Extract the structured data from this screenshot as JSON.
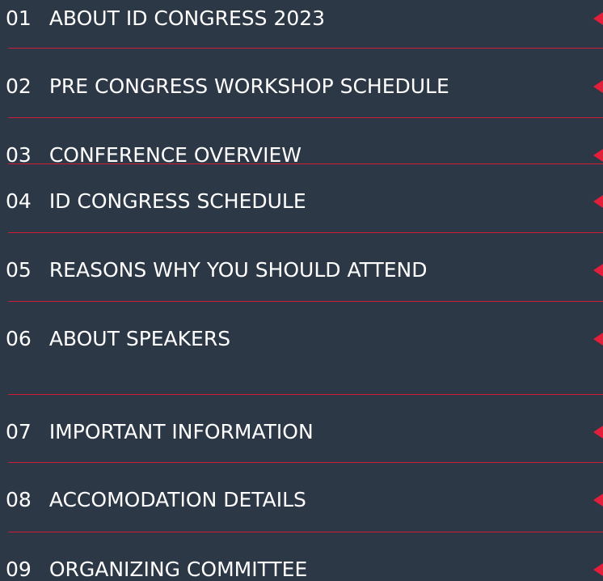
{
  "menu": {
    "accent_color": "#e31e3a",
    "background_color": "#2d3847",
    "items": [
      {
        "number": "01",
        "title": "ABOUT ID CONGRESS 2023",
        "icon": "caret-left-icon"
      },
      {
        "number": "02",
        "title": "PRE CONGRESS WORKSHOP SCHEDULE",
        "icon": "caret-left-icon"
      },
      {
        "number": "03",
        "title": "CONFERENCE OVERVIEW",
        "icon": "caret-left-icon"
      },
      {
        "number": "04",
        "title": "ID CONGRESS SCHEDULE",
        "icon": "caret-left-icon"
      },
      {
        "number": "05",
        "title": "REASONS WHY YOU SHOULD ATTEND",
        "icon": "caret-left-icon"
      },
      {
        "number": "06",
        "title": "ABOUT SPEAKERS",
        "icon": "caret-left-icon"
      },
      {
        "number": "07",
        "title": "IMPORTANT INFORMATION",
        "icon": "caret-left-icon"
      },
      {
        "number": "08",
        "title": "ACCOMODATION DETAILS",
        "icon": "caret-left-icon"
      },
      {
        "number": "09",
        "title": "ORGANIZING COMMITTEE",
        "icon": "caret-left-icon"
      }
    ]
  }
}
